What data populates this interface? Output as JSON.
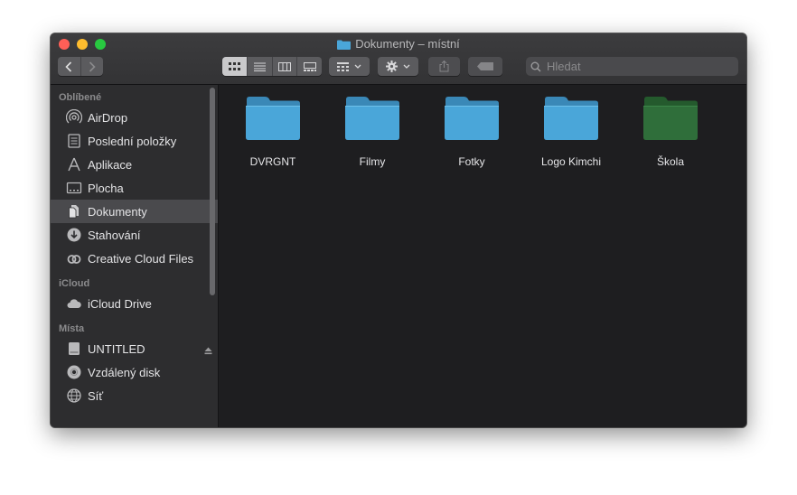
{
  "window": {
    "title": "Dokumenty – místní"
  },
  "toolbar": {
    "back": "back",
    "forward": "forward",
    "view_modes": [
      "icon-view",
      "list-view",
      "column-view",
      "gallery-view"
    ],
    "search_placeholder": "Hledat"
  },
  "sidebar": {
    "sections": [
      {
        "header": "Oblíbené",
        "items": [
          {
            "label": "AirDrop",
            "icon": "airdrop-icon"
          },
          {
            "label": "Poslední položky",
            "icon": "recents-icon"
          },
          {
            "label": "Aplikace",
            "icon": "applications-icon"
          },
          {
            "label": "Plocha",
            "icon": "desktop-icon"
          },
          {
            "label": "Dokumenty",
            "icon": "documents-icon",
            "selected": true
          },
          {
            "label": "Stahování",
            "icon": "downloads-icon"
          },
          {
            "label": "Creative Cloud Files",
            "icon": "creative-cloud-icon"
          }
        ]
      },
      {
        "header": "iCloud",
        "items": [
          {
            "label": "iCloud Drive",
            "icon": "cloud-icon"
          }
        ]
      },
      {
        "header": "Místa",
        "items": [
          {
            "label": "UNTITLED",
            "icon": "drive-icon",
            "ejectable": true
          },
          {
            "label": "Vzdálený disk",
            "icon": "disc-icon"
          },
          {
            "label": "Síť",
            "icon": "network-icon"
          }
        ]
      }
    ]
  },
  "files": [
    {
      "name": "DVRGNT",
      "color": "#4aa6d9"
    },
    {
      "name": "Filmy",
      "color": "#4aa6d9"
    },
    {
      "name": "Fotky",
      "color": "#4aa6d9"
    },
    {
      "name": "Logo Kimchi",
      "color": "#4aa6d9"
    },
    {
      "name": "Škola",
      "color": "#2f6e3a"
    }
  ],
  "colors": {
    "folder_blue": "#4aa6d9",
    "folder_green": "#2f6e3a",
    "window_bg": "#1e1e20",
    "sidebar_bg": "#2d2d2f"
  }
}
